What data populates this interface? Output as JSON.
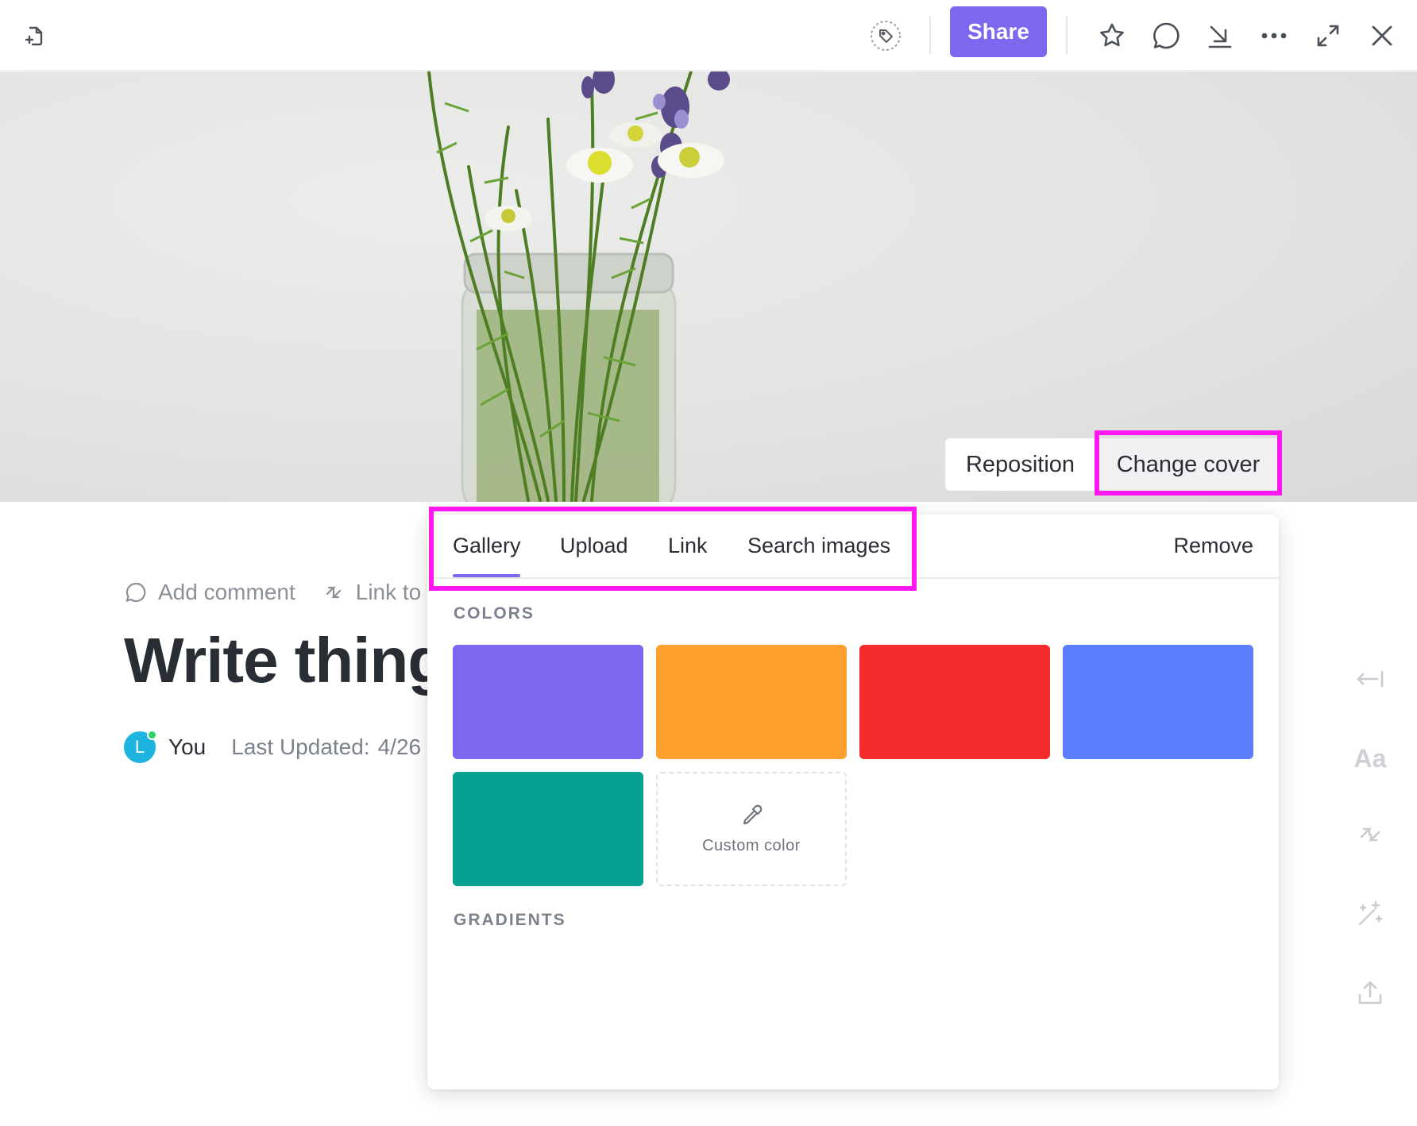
{
  "topbar": {
    "share_label": "Share",
    "icons": [
      "doc-add-icon",
      "tag-icon",
      "star-icon",
      "comment-icon",
      "download-icon",
      "more-icon",
      "expand-icon",
      "close-icon"
    ]
  },
  "cover": {
    "reposition_label": "Reposition",
    "change_cover_label": "Change cover"
  },
  "doc": {
    "actions": {
      "add_comment": "Add comment",
      "link_to": "Link to"
    },
    "title": "Write thing",
    "meta": {
      "avatar_initial": "L",
      "you": "You",
      "last_updated_label": "Last Updated:",
      "last_updated_value": "4/26"
    }
  },
  "popover": {
    "tabs": [
      {
        "label": "Gallery",
        "active": true
      },
      {
        "label": "Upload",
        "active": false
      },
      {
        "label": "Link",
        "active": false
      },
      {
        "label": "Search images",
        "active": false
      }
    ],
    "remove_label": "Remove",
    "colors_heading": "COLORS",
    "gradients_heading": "GRADIENTS",
    "colors": [
      "#7b68ee",
      "#ffa12f",
      "#f42c2c",
      "#5b7ffe",
      "#06a093"
    ],
    "custom_color_label": "Custom color"
  },
  "right_rail": {
    "icons": [
      "collapse-left-icon",
      "typography-icon",
      "link-icon",
      "ai-sparkle-icon",
      "export-icon"
    ],
    "typography_label": "Aa"
  },
  "theme": {
    "accent": "#7b68ee",
    "highlight": "#ff18f2"
  }
}
